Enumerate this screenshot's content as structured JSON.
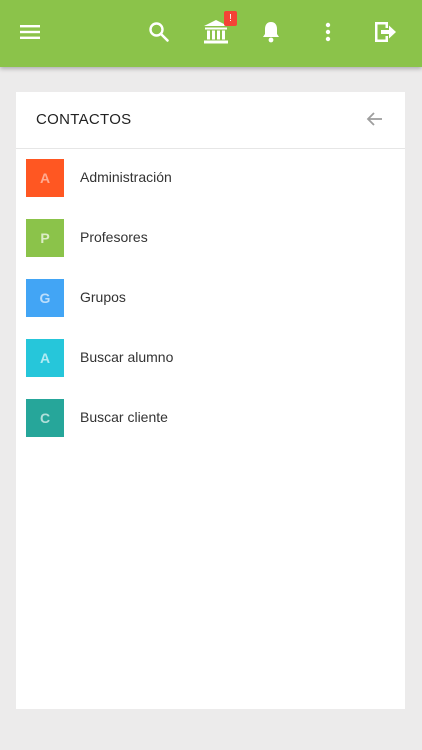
{
  "toolbar": {
    "icons": [
      "menu-icon",
      "search-icon",
      "institution-icon",
      "bell-icon",
      "more-vert-icon",
      "logout-icon"
    ],
    "badge": "!",
    "colors": {
      "background": "#8bc34a",
      "icon": "#ffffff",
      "badge": "#f44336"
    }
  },
  "contacts": {
    "title": "CONTACTOS",
    "back_icon": "arrow-left-icon",
    "items": [
      {
        "letter": "A",
        "label": "Administración",
        "bg": "#ff5722",
        "fg": "#ffab91"
      },
      {
        "letter": "P",
        "label": "Profesores",
        "bg": "#8bc34a",
        "fg": "#dcedc8"
      },
      {
        "letter": "G",
        "label": "Grupos",
        "bg": "#42a5f5",
        "fg": "#bbdefb"
      },
      {
        "letter": "A",
        "label": "Buscar alumno",
        "bg": "#26c6da",
        "fg": "#b2ebf2"
      },
      {
        "letter": "C",
        "label": "Buscar cliente",
        "bg": "#26a69a",
        "fg": "#b2dfdb"
      }
    ]
  }
}
